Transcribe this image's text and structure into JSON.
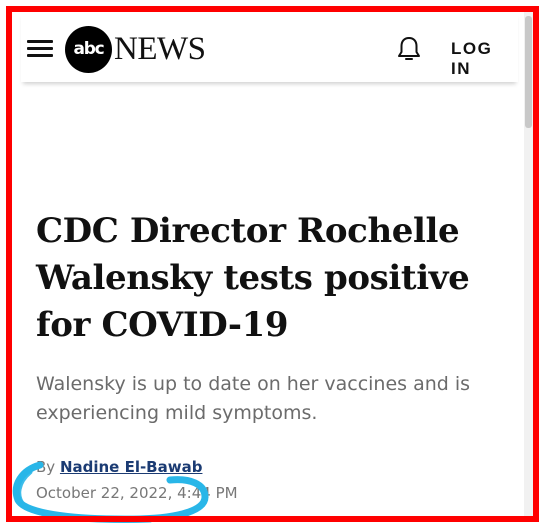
{
  "header": {
    "logo_abc": "abc",
    "logo_news": "NEWS",
    "login_label": "LOG IN",
    "menu_icon": "hamburger-menu-icon",
    "bell_icon": "notification-bell-icon"
  },
  "article": {
    "headline": "CDC Director Rochelle Walensky tests positive for COVID-19",
    "subheadline": "Walensky is up to date on her vaccines and is experiencing mild symptoms.",
    "byline_prefix": "By ",
    "author": "Nadine El-Bawab",
    "timestamp": "October 22, 2022, 4:44 PM"
  },
  "colors": {
    "frame": "#ff0000",
    "annotation": "#29b6e8",
    "author_link": "#1b3b73"
  }
}
